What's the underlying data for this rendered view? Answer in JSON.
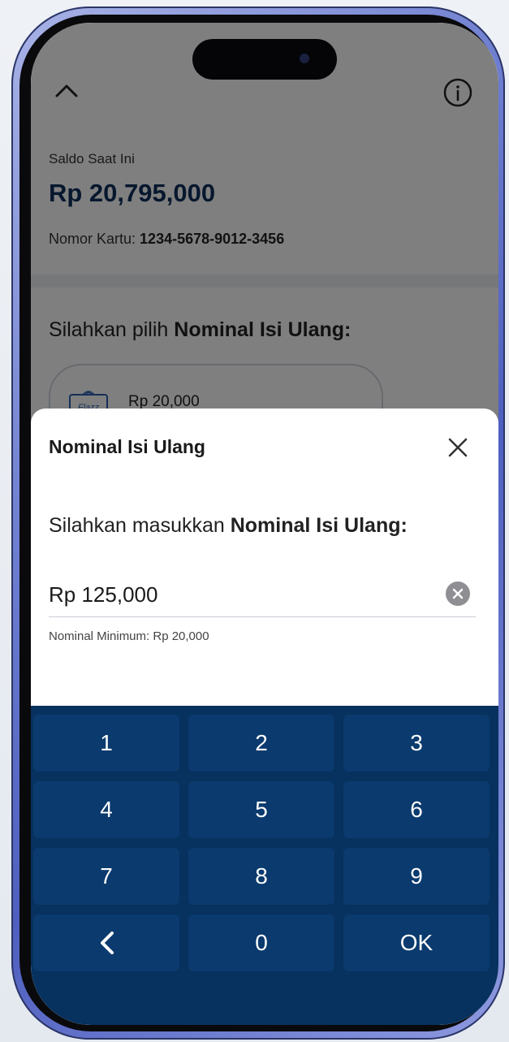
{
  "account": {
    "balance_label": "Saldo Saat Ini",
    "balance_value": "Rp 20,795,000",
    "card_label": "Nomor Kartu: ",
    "card_number": "1234-5678-9012-3456"
  },
  "topup": {
    "choose_prefix": "Silahkan pilih ",
    "choose_bold": "Nominal Isi Ulang:",
    "options": [
      {
        "label": "Rp 20,000",
        "icon": "flazz-card-icon"
      }
    ]
  },
  "sheet": {
    "title": "Nominal Isi Ulang",
    "instruction_prefix": "Silahkan masukkan ",
    "instruction_bold": "Nominal Isi Ulang:",
    "amount_value": "Rp 125,000",
    "hint": "Nominal Minimum: Rp 20,000"
  },
  "keypad": {
    "keys": [
      "1",
      "2",
      "3",
      "4",
      "5",
      "6",
      "7",
      "8",
      "9",
      "‹",
      "0",
      "OK"
    ]
  },
  "icons": {
    "collapse": "chevron-up-icon",
    "info": "info-icon",
    "close": "close-icon",
    "clear": "clear-circle-icon",
    "back": "backspace-chevron-icon"
  },
  "colors": {
    "brand_navy": "#0d2e5c",
    "keypad_bg": "#07315e",
    "key_bg": "#0a3a6e",
    "overlay": "rgba(0,0,0,0.5)"
  }
}
